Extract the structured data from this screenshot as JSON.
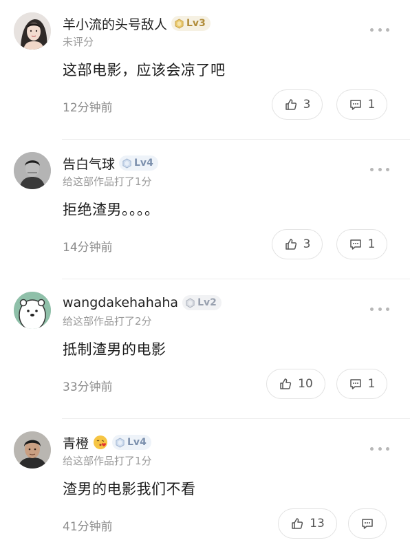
{
  "comments": [
    {
      "username": "羊小流的头号敌人",
      "level": "Lv3",
      "level_style": "gold",
      "rating_text": "未评分",
      "text": "这部电影，应该会凉了吧",
      "time": "12分钟前",
      "likes": "3",
      "replies": "1",
      "has_emoji": false
    },
    {
      "username": "告白气球",
      "level": "Lv4",
      "level_style": "blue",
      "rating_text": "给这部作品打了1分",
      "text": "拒绝渣男。。。。",
      "time": "14分钟前",
      "likes": "3",
      "replies": "1",
      "has_emoji": false
    },
    {
      "username": "wangdakehahaha",
      "level": "Lv2",
      "level_style": "grey",
      "rating_text": "给这部作品打了2分",
      "text": "抵制渣男的电影",
      "time": "33分钟前",
      "likes": "10",
      "replies": "1",
      "has_emoji": false
    },
    {
      "username": "青橙",
      "level": "Lv4",
      "level_style": "blue",
      "rating_text": "给这部作品打了1分",
      "text": "渣男的电影我们不看",
      "time": "41分钟前",
      "likes": "13",
      "replies": "",
      "has_emoji": true,
      "emoji_icon": "kissing-face-emoji"
    }
  ],
  "icons": {
    "like": "thumbs-up-icon",
    "reply": "comment-bubble-icon",
    "more": "more-dots-icon",
    "level": "level-gem-icon"
  },
  "colors": {
    "level_gold": "#b18d3b",
    "level_blue": "#7c90ad",
    "level_grey": "#98a0ae",
    "meta_text": "#9a9a9a"
  }
}
